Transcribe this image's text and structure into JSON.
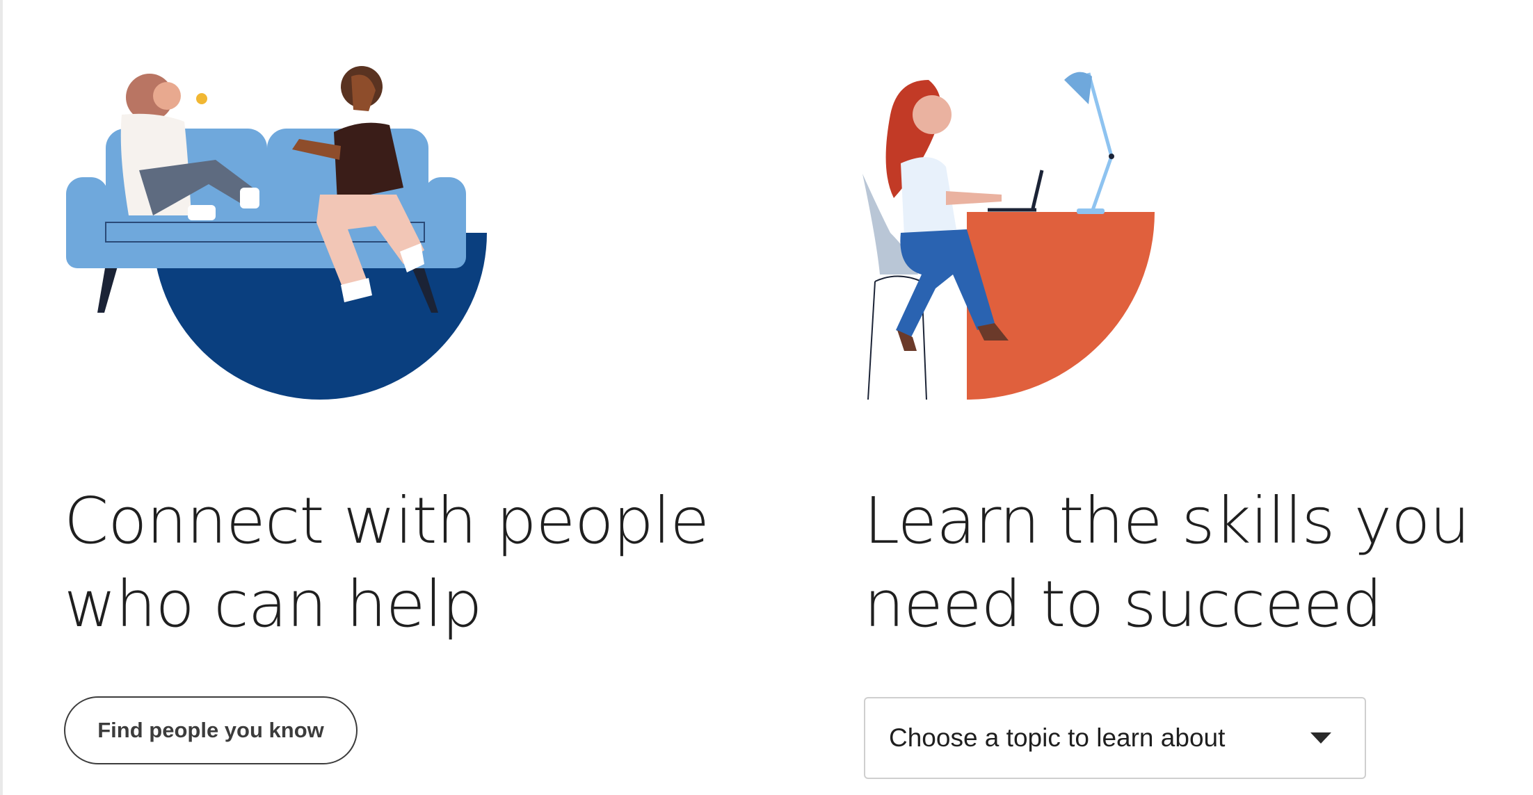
{
  "colors": {
    "headline": "#1f1f1f",
    "button_border": "#3c3c3c",
    "select_border": "#cfcfcf",
    "sofa_blue": "#6fa8dc",
    "deep_blue": "#0a3f7f",
    "desk_orange": "#e0603d",
    "jeans_blue": "#2a63b1"
  },
  "connect_section": {
    "illustration_icon": "people-on-sofa-illustration",
    "headline_line1": "Connect with people",
    "headline_line2": "who can help",
    "button_label": "Find people you know"
  },
  "learn_section": {
    "illustration_icon": "person-at-desk-illustration",
    "headline_line1": "Learn the skills you",
    "headline_line2": "need to succeed",
    "select_value": "Choose a topic to learn about",
    "select_icon": "caret-down-icon"
  }
}
